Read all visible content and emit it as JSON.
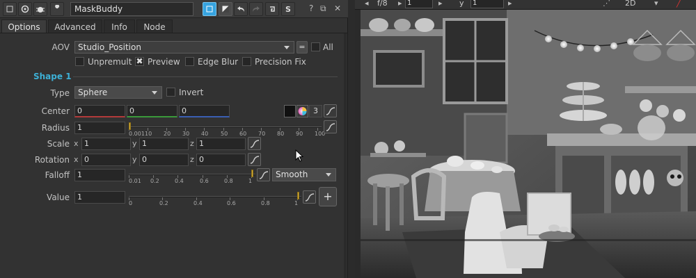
{
  "node_name": "MaskBuddy",
  "tabs": [
    "Options",
    "Advanced",
    "Info",
    "Node"
  ],
  "aov": {
    "label": "AOV",
    "value": "Studio_Position",
    "equals_label": "=",
    "all_label": "All"
  },
  "options": {
    "unpremult": "Unpremult",
    "preview": "Preview",
    "edge_blur": "Edge Blur",
    "precision_fix": "Precision Fix"
  },
  "shape": {
    "header": "Shape 1",
    "type_label": "Type",
    "type_value": "Sphere",
    "invert_label": "Invert",
    "center_label": "Center",
    "center_values": [
      "0",
      "0",
      "0"
    ],
    "channels_count": "3",
    "radius_label": "Radius",
    "radius_value": "1",
    "radius_ticks": [
      "0.001",
      "10",
      "20",
      "30",
      "40",
      "50",
      "60",
      "70",
      "80",
      "90",
      "100"
    ],
    "radius_level": 0.0,
    "scale_label": "Scale",
    "scale_values": [
      "1",
      "1",
      "1"
    ],
    "rotation_label": "Rotation",
    "rotation_values": [
      "0",
      "0",
      "0"
    ],
    "axes": [
      "x",
      "y",
      "z"
    ],
    "falloff_label": "Falloff",
    "falloff_value": "1",
    "falloff_ticks": [
      "0.01",
      "0.2",
      "0.4",
      "0.6",
      "0.8",
      "1"
    ],
    "falloff_level": 1.0,
    "falloff_mode": "Smooth",
    "value_label": "Value",
    "value_value": "1",
    "value_ticks": [
      "0",
      "0.2",
      "0.4",
      "0.6",
      "0.8",
      "1"
    ],
    "value_level": 1.0,
    "add_label": "+"
  },
  "viewer": {
    "fstop": "f/8",
    "frame": "1",
    "y_label": "y",
    "y_value": "1",
    "view_mode": "2D"
  },
  "colors": {
    "accent": "#36a3e0",
    "shape_header": "#3db0d6",
    "slider_handle": "#d8b23c"
  }
}
